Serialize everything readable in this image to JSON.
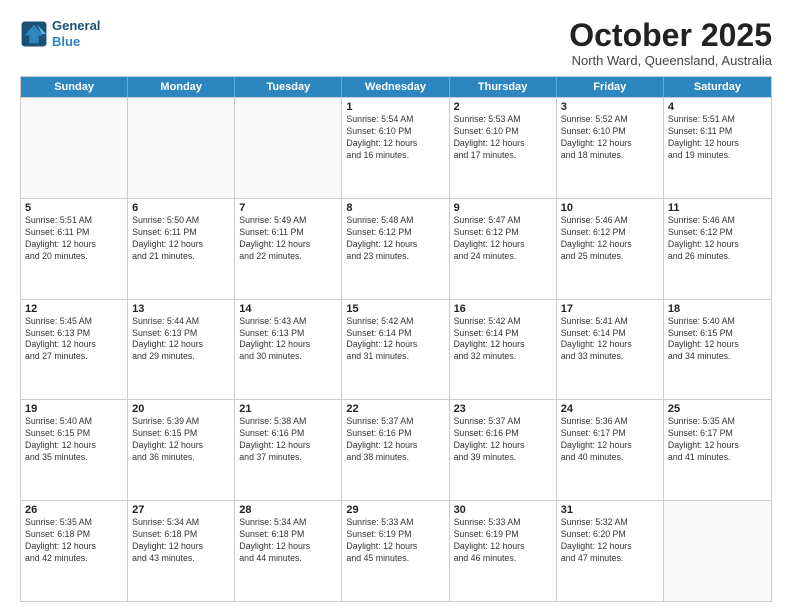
{
  "header": {
    "logo_line1": "General",
    "logo_line2": "Blue",
    "month": "October 2025",
    "location": "North Ward, Queensland, Australia"
  },
  "weekdays": [
    "Sunday",
    "Monday",
    "Tuesday",
    "Wednesday",
    "Thursday",
    "Friday",
    "Saturday"
  ],
  "weeks": [
    [
      {
        "day": "",
        "text": ""
      },
      {
        "day": "",
        "text": ""
      },
      {
        "day": "",
        "text": ""
      },
      {
        "day": "1",
        "text": "Sunrise: 5:54 AM\nSunset: 6:10 PM\nDaylight: 12 hours\nand 16 minutes."
      },
      {
        "day": "2",
        "text": "Sunrise: 5:53 AM\nSunset: 6:10 PM\nDaylight: 12 hours\nand 17 minutes."
      },
      {
        "day": "3",
        "text": "Sunrise: 5:52 AM\nSunset: 6:10 PM\nDaylight: 12 hours\nand 18 minutes."
      },
      {
        "day": "4",
        "text": "Sunrise: 5:51 AM\nSunset: 6:11 PM\nDaylight: 12 hours\nand 19 minutes."
      }
    ],
    [
      {
        "day": "5",
        "text": "Sunrise: 5:51 AM\nSunset: 6:11 PM\nDaylight: 12 hours\nand 20 minutes."
      },
      {
        "day": "6",
        "text": "Sunrise: 5:50 AM\nSunset: 6:11 PM\nDaylight: 12 hours\nand 21 minutes."
      },
      {
        "day": "7",
        "text": "Sunrise: 5:49 AM\nSunset: 6:11 PM\nDaylight: 12 hours\nand 22 minutes."
      },
      {
        "day": "8",
        "text": "Sunrise: 5:48 AM\nSunset: 6:12 PM\nDaylight: 12 hours\nand 23 minutes."
      },
      {
        "day": "9",
        "text": "Sunrise: 5:47 AM\nSunset: 6:12 PM\nDaylight: 12 hours\nand 24 minutes."
      },
      {
        "day": "10",
        "text": "Sunrise: 5:46 AM\nSunset: 6:12 PM\nDaylight: 12 hours\nand 25 minutes."
      },
      {
        "day": "11",
        "text": "Sunrise: 5:46 AM\nSunset: 6:12 PM\nDaylight: 12 hours\nand 26 minutes."
      }
    ],
    [
      {
        "day": "12",
        "text": "Sunrise: 5:45 AM\nSunset: 6:13 PM\nDaylight: 12 hours\nand 27 minutes."
      },
      {
        "day": "13",
        "text": "Sunrise: 5:44 AM\nSunset: 6:13 PM\nDaylight: 12 hours\nand 29 minutes."
      },
      {
        "day": "14",
        "text": "Sunrise: 5:43 AM\nSunset: 6:13 PM\nDaylight: 12 hours\nand 30 minutes."
      },
      {
        "day": "15",
        "text": "Sunrise: 5:42 AM\nSunset: 6:14 PM\nDaylight: 12 hours\nand 31 minutes."
      },
      {
        "day": "16",
        "text": "Sunrise: 5:42 AM\nSunset: 6:14 PM\nDaylight: 12 hours\nand 32 minutes."
      },
      {
        "day": "17",
        "text": "Sunrise: 5:41 AM\nSunset: 6:14 PM\nDaylight: 12 hours\nand 33 minutes."
      },
      {
        "day": "18",
        "text": "Sunrise: 5:40 AM\nSunset: 6:15 PM\nDaylight: 12 hours\nand 34 minutes."
      }
    ],
    [
      {
        "day": "19",
        "text": "Sunrise: 5:40 AM\nSunset: 6:15 PM\nDaylight: 12 hours\nand 35 minutes."
      },
      {
        "day": "20",
        "text": "Sunrise: 5:39 AM\nSunset: 6:15 PM\nDaylight: 12 hours\nand 36 minutes."
      },
      {
        "day": "21",
        "text": "Sunrise: 5:38 AM\nSunset: 6:16 PM\nDaylight: 12 hours\nand 37 minutes."
      },
      {
        "day": "22",
        "text": "Sunrise: 5:37 AM\nSunset: 6:16 PM\nDaylight: 12 hours\nand 38 minutes."
      },
      {
        "day": "23",
        "text": "Sunrise: 5:37 AM\nSunset: 6:16 PM\nDaylight: 12 hours\nand 39 minutes."
      },
      {
        "day": "24",
        "text": "Sunrise: 5:36 AM\nSunset: 6:17 PM\nDaylight: 12 hours\nand 40 minutes."
      },
      {
        "day": "25",
        "text": "Sunrise: 5:35 AM\nSunset: 6:17 PM\nDaylight: 12 hours\nand 41 minutes."
      }
    ],
    [
      {
        "day": "26",
        "text": "Sunrise: 5:35 AM\nSunset: 6:18 PM\nDaylight: 12 hours\nand 42 minutes."
      },
      {
        "day": "27",
        "text": "Sunrise: 5:34 AM\nSunset: 6:18 PM\nDaylight: 12 hours\nand 43 minutes."
      },
      {
        "day": "28",
        "text": "Sunrise: 5:34 AM\nSunset: 6:18 PM\nDaylight: 12 hours\nand 44 minutes."
      },
      {
        "day": "29",
        "text": "Sunrise: 5:33 AM\nSunset: 6:19 PM\nDaylight: 12 hours\nand 45 minutes."
      },
      {
        "day": "30",
        "text": "Sunrise: 5:33 AM\nSunset: 6:19 PM\nDaylight: 12 hours\nand 46 minutes."
      },
      {
        "day": "31",
        "text": "Sunrise: 5:32 AM\nSunset: 6:20 PM\nDaylight: 12 hours\nand 47 minutes."
      },
      {
        "day": "",
        "text": ""
      }
    ]
  ]
}
